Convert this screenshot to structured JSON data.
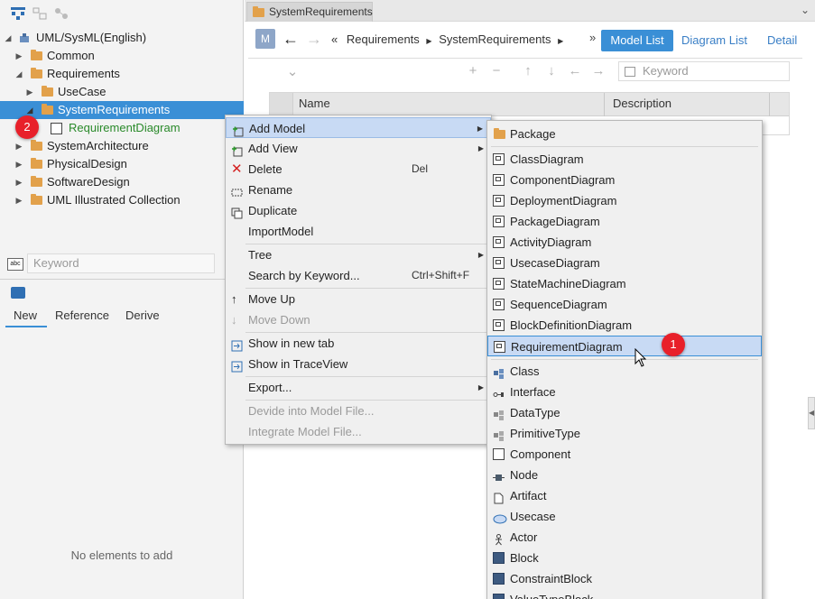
{
  "left_panel": {
    "tree": {
      "root": "UML/SysML(English)",
      "items": [
        {
          "label": "Common"
        },
        {
          "label": "Requirements"
        },
        {
          "label": "UseCase"
        },
        {
          "label": "SystemRequirements"
        },
        {
          "label": "RequirementDiagram"
        },
        {
          "label": "SystemArchitecture"
        },
        {
          "label": "PhysicalDesign"
        },
        {
          "label": "SoftwareDesign"
        },
        {
          "label": "UML Illustrated Collection"
        }
      ]
    },
    "search": {
      "placeholder": "Keyword"
    },
    "sub_tabs": [
      {
        "label": "New"
      },
      {
        "label": "Reference"
      },
      {
        "label": "Derive"
      }
    ],
    "empty_message": "No elements to add"
  },
  "editor": {
    "tab_title": "SystemRequirements",
    "m_badge": "M",
    "breadcrumb": {
      "prefix": "«",
      "parts": [
        "Requirements",
        "SystemRequirements"
      ]
    },
    "more": "»",
    "view_buttons": {
      "model_list": "Model List",
      "diagram_list": "Diagram List",
      "detail": "Detail"
    },
    "list_search_placeholder": "Keyword",
    "columns": [
      "Name",
      "Description"
    ]
  },
  "context_menu": {
    "items": [
      {
        "label": "Add Model"
      },
      {
        "label": "Add View"
      },
      {
        "label": "Delete",
        "shortcut": "Del"
      },
      {
        "label": "Rename"
      },
      {
        "label": "Duplicate"
      },
      {
        "label": "ImportModel"
      },
      {
        "label": "Tree"
      },
      {
        "label": "Search by Keyword...",
        "shortcut": "Ctrl+Shift+F"
      },
      {
        "label": "Move Up"
      },
      {
        "label": "Move Down"
      },
      {
        "label": "Show in new tab"
      },
      {
        "label": "Show in TraceView"
      },
      {
        "label": "Export..."
      },
      {
        "label": "Devide into Model File..."
      },
      {
        "label": "Integrate Model File..."
      }
    ]
  },
  "submenu": {
    "items": [
      {
        "label": "Package"
      },
      {
        "label": "ClassDiagram"
      },
      {
        "label": "ComponentDiagram"
      },
      {
        "label": "DeploymentDiagram"
      },
      {
        "label": "PackageDiagram"
      },
      {
        "label": "ActivityDiagram"
      },
      {
        "label": "UsecaseDiagram"
      },
      {
        "label": "StateMachineDiagram"
      },
      {
        "label": "SequenceDiagram"
      },
      {
        "label": "BlockDefinitionDiagram"
      },
      {
        "label": "RequirementDiagram"
      },
      {
        "label": "Class"
      },
      {
        "label": "Interface"
      },
      {
        "label": "DataType"
      },
      {
        "label": "PrimitiveType"
      },
      {
        "label": "Component"
      },
      {
        "label": "Node"
      },
      {
        "label": "Artifact"
      },
      {
        "label": "Usecase"
      },
      {
        "label": "Actor"
      },
      {
        "label": "Block"
      },
      {
        "label": "ConstraintBlock"
      },
      {
        "label": "ValueTypeBlock"
      }
    ]
  },
  "badges": {
    "step1": "1",
    "step2": "2"
  },
  "colors": {
    "accent": "#3a8fd6",
    "folder": "#e2a14b",
    "badge": "#e8202a",
    "highlight": "#c8daf4"
  }
}
